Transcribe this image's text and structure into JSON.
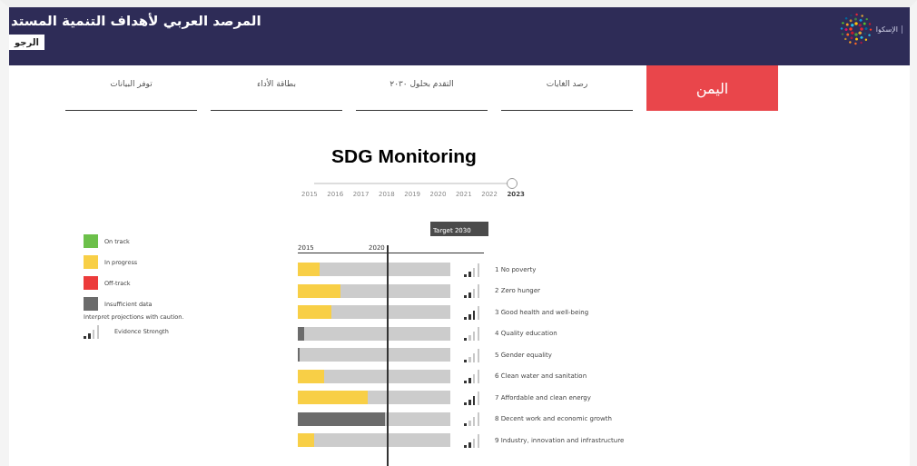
{
  "header": {
    "title": "المرصد العربي لأهداف التنمية المستد",
    "back_button": "الرجو",
    "logo_text": "الإسكوا"
  },
  "tabs": [
    {
      "label": "اليمن",
      "selected": true
    },
    {
      "label": "رصد الغايات",
      "selected": false
    },
    {
      "label": "التقدم بحلول ٢٠٣٠",
      "selected": false
    },
    {
      "label": "بطاقة الأداء",
      "selected": false
    },
    {
      "label": "توفر البيانات",
      "selected": false
    }
  ],
  "heading": "SDG Monitoring",
  "year_slider": {
    "level": 1,
    "years": [
      {
        "label": "2015",
        "selected": false
      },
      {
        "label": "2016",
        "selected": false
      },
      {
        "label": "2017",
        "selected": false
      },
      {
        "label": "2018",
        "selected": false
      },
      {
        "label": "2019",
        "selected": false
      },
      {
        "label": "2020",
        "selected": false
      },
      {
        "label": "2021",
        "selected": false
      },
      {
        "label": "2022",
        "selected": false
      },
      {
        "label": "2023",
        "selected": true
      }
    ]
  },
  "legend": {
    "items": [
      {
        "label": "On track",
        "color": "#6cc04a"
      },
      {
        "label": "In progress",
        "color": "#f8cf46"
      },
      {
        "label": "Off-track",
        "color": "#ec3b3b"
      },
      {
        "label": "Insufficient data",
        "color": "#6b6b6b"
      }
    ],
    "note": "Interpret projections with caution.",
    "evidence": {
      "label": "Evidence Strength",
      "level": 0.5
    }
  },
  "chart": {
    "axis_start": "2015",
    "axis_mid": "2020",
    "target": "Target 2030",
    "rows": [
      {
        "label": "1 No poverty",
        "kind": "progress",
        "level": 0.14,
        "evidence": {
          "level": 0.5
        }
      },
      {
        "label": "2 Zero hunger",
        "kind": "progress",
        "level": 0.28,
        "evidence": {
          "level": 0.5
        }
      },
      {
        "label": "3 Good health and well-being",
        "kind": "progress",
        "level": 0.22,
        "evidence": {
          "level": 0.75
        }
      },
      {
        "label": "4 Quality education",
        "kind": "insufficient",
        "level": 0.04,
        "evidence": {
          "level": 0.25
        }
      },
      {
        "label": "5 Gender equality",
        "kind": "insufficient",
        "level": 0.01,
        "evidence": {
          "level": 0.25
        }
      },
      {
        "label": "6 Clean water and sanitation",
        "kind": "progress",
        "level": 0.17,
        "evidence": {
          "level": 0.5
        }
      },
      {
        "label": "7 Affordable and clean energy",
        "kind": "progress",
        "level": 0.46,
        "evidence": {
          "level": 0.75
        }
      },
      {
        "label": "8 Decent work and economic growth",
        "kind": "insufficient",
        "level": 0.57,
        "evidence": {
          "level": 0.25
        }
      },
      {
        "label": "9 Industry, innovation and infrastructure",
        "kind": "progress",
        "level": 0.11,
        "evidence": {
          "level": 0.5
        }
      }
    ]
  }
}
